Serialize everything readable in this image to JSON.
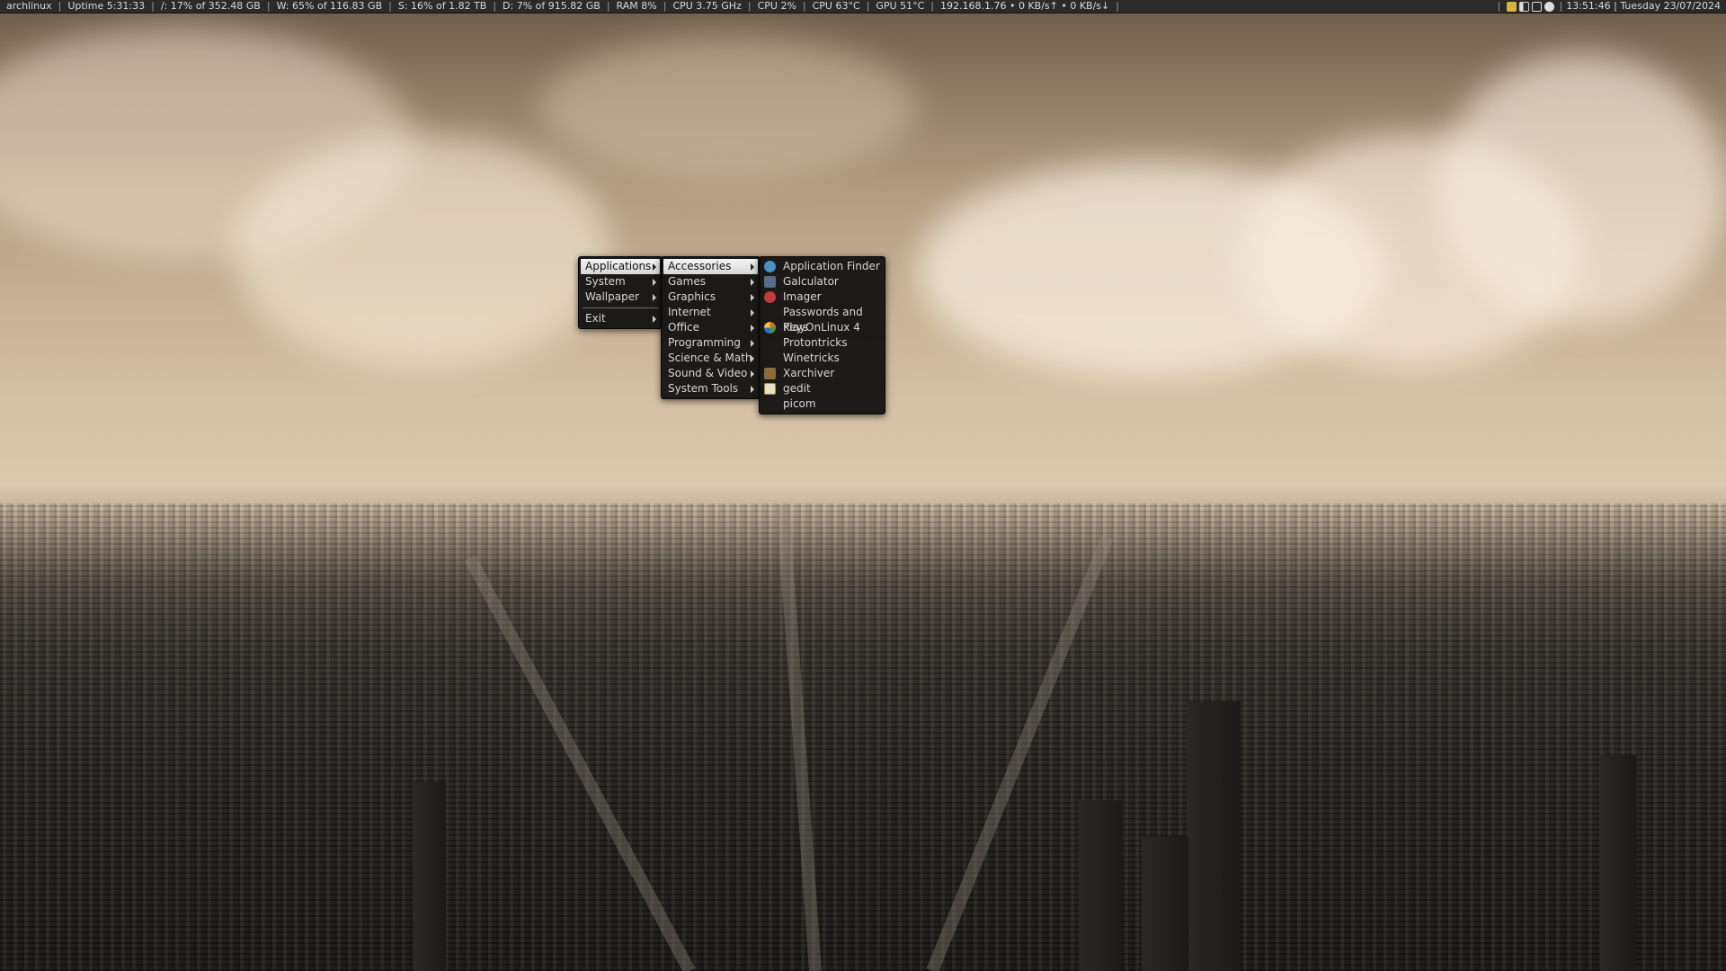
{
  "panel": {
    "stats": [
      "archlinux",
      "Uptime 5:31:33",
      "/: 17% of 352.48 GB",
      "W: 65% of 116.83 GB",
      "S: 16% of 1.82 TB",
      "D: 7% of 915.82 GB",
      "RAM 8%",
      "CPU 3.75 GHz",
      "CPU 2%",
      "CPU 63°C",
      "GPU 51°C",
      "192.168.1.76 • 0 KB/s↑ • 0 KB/s↓"
    ],
    "separator": "|",
    "tray_icons": [
      "clipboard-icon",
      "volume-icon",
      "network-icon",
      "update-icon"
    ],
    "clock": "13:51:46 | Tuesday 23/07/2024"
  },
  "menu_root": {
    "items": [
      {
        "label": "Applications",
        "submenu": true,
        "active": true
      },
      {
        "label": "System",
        "submenu": true
      },
      {
        "label": "Wallpaper",
        "submenu": true
      },
      {
        "divider": true
      },
      {
        "label": "Exit",
        "submenu": true
      }
    ]
  },
  "menu_applications": {
    "items": [
      {
        "label": "Accessories",
        "submenu": true,
        "active": true
      },
      {
        "label": "Games",
        "submenu": true
      },
      {
        "label": "Graphics",
        "submenu": true
      },
      {
        "label": "Internet",
        "submenu": true
      },
      {
        "label": "Office",
        "submenu": true
      },
      {
        "label": "Programming",
        "submenu": true
      },
      {
        "label": "Science & Math",
        "submenu": true
      },
      {
        "label": "Sound & Video",
        "submenu": true
      },
      {
        "label": "System Tools",
        "submenu": true
      }
    ]
  },
  "menu_accessories": {
    "items": [
      {
        "label": "Application Finder",
        "icon": "app-finder-icon",
        "icon_color": "#4a90c8"
      },
      {
        "label": "Galculator",
        "icon": "calculator-icon",
        "icon_color": "#5a6a8a"
      },
      {
        "label": "Imager",
        "icon": "imager-icon",
        "icon_color": "#c03a3a"
      },
      {
        "label": "Passwords and Keys",
        "icon": "",
        "icon_color": ""
      },
      {
        "label": "PlayOnLinux 4",
        "icon": "playonlinux-icon",
        "icon_color": "#d86a2a"
      },
      {
        "label": "Protontricks",
        "icon": "",
        "icon_color": ""
      },
      {
        "label": "Winetricks",
        "icon": "",
        "icon_color": ""
      },
      {
        "label": "Xarchiver",
        "icon": "xarchiver-icon",
        "icon_color": "#8a6a3a"
      },
      {
        "label": "gedit",
        "icon": "gedit-icon",
        "icon_color": "#e8e0c8"
      },
      {
        "label": "picom",
        "icon": "",
        "icon_color": ""
      }
    ]
  }
}
